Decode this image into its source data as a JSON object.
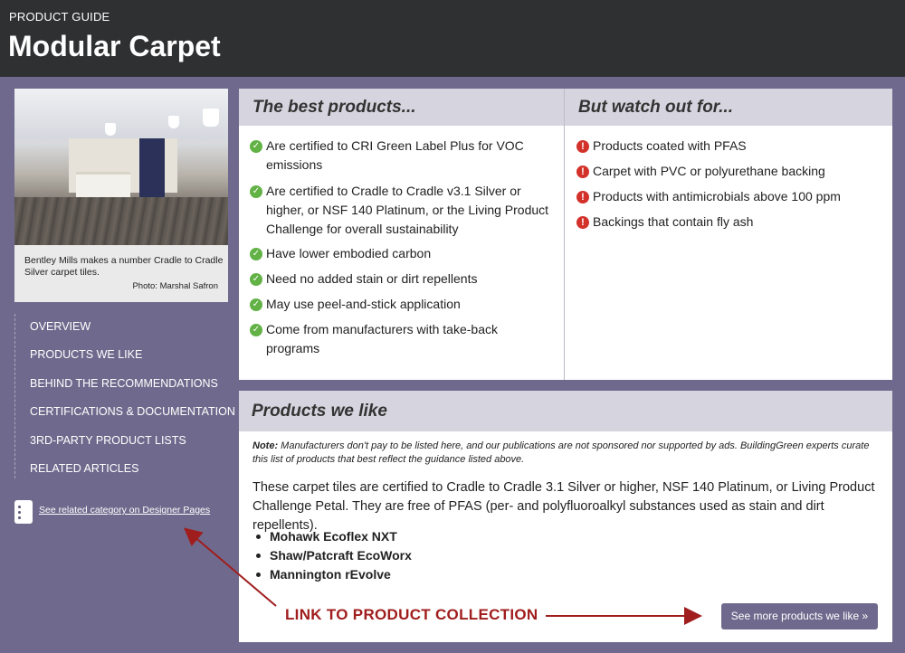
{
  "header": {
    "kicker": "PRODUCT GUIDE",
    "title": "Modular Carpet"
  },
  "photo": {
    "caption": "Bentley Mills makes a number Cradle to Cradle Silver carpet tiles.",
    "credit": "Photo: Marshal Safron"
  },
  "nav": {
    "items": [
      "OVERVIEW",
      "PRODUCTS WE LIKE",
      "BEHIND THE RECOMMENDATIONS",
      "CERTIFICATIONS & DOCUMENTATION",
      "3RD-PARTY PRODUCT LISTS",
      "RELATED ARTICLES"
    ],
    "designer_link": "See related category on Designer Pages"
  },
  "best": {
    "title": "The best products...",
    "items": [
      "Are certified to CRI Green Label Plus for VOC emissions",
      "Are certified to Cradle to Cradle v3.1 Silver or higher, or NSF 140 Platinum, or the Living Product Challenge for overall sustainability",
      "Have lower embodied carbon",
      "Need no added stain or dirt repellents",
      "May use peel-and-stick application",
      "Come from manufacturers with take-back programs"
    ]
  },
  "watch": {
    "title": "But watch out for...",
    "items": [
      "Products coated with PFAS",
      "Carpet with PVC or polyurethane backing",
      "Products with antimicrobials above 100 ppm",
      "Backings that contain fly ash"
    ]
  },
  "products": {
    "title": "Products we like",
    "note_label": "Note:",
    "note_text": " Manufacturers don't pay to be listed here, and our publications are not sponsored nor supported by ads. BuildingGreen experts curate this list of products that best reflect the guidance listed above.",
    "description": "These carpet tiles are certified to Cradle to Cradle 3.1 Silver or higher, NSF 140 Platinum, or Living Product Challenge Petal. They are free of PFAS (per- and polyfluoroalkyl substances used as stain and dirt repellents).",
    "list": [
      "Mohawk Ecoflex NXT",
      "Shaw/Patcraft EcoWorx",
      "Mannington rEvolve"
    ],
    "more_button": "See more products we like »"
  },
  "annotation": "LINK TO PRODUCT COLLECTION",
  "colors": {
    "header_bg": "#2f3032",
    "page_bg": "#6f6a8d",
    "panel_head": "#d6d5df",
    "check": "#62b246",
    "warn": "#d3322a",
    "annotation": "#a01d1d"
  },
  "icons": {
    "check": "check-circle-icon",
    "warn": "exclamation-circle-icon",
    "designer": "designer-pages-icon"
  }
}
